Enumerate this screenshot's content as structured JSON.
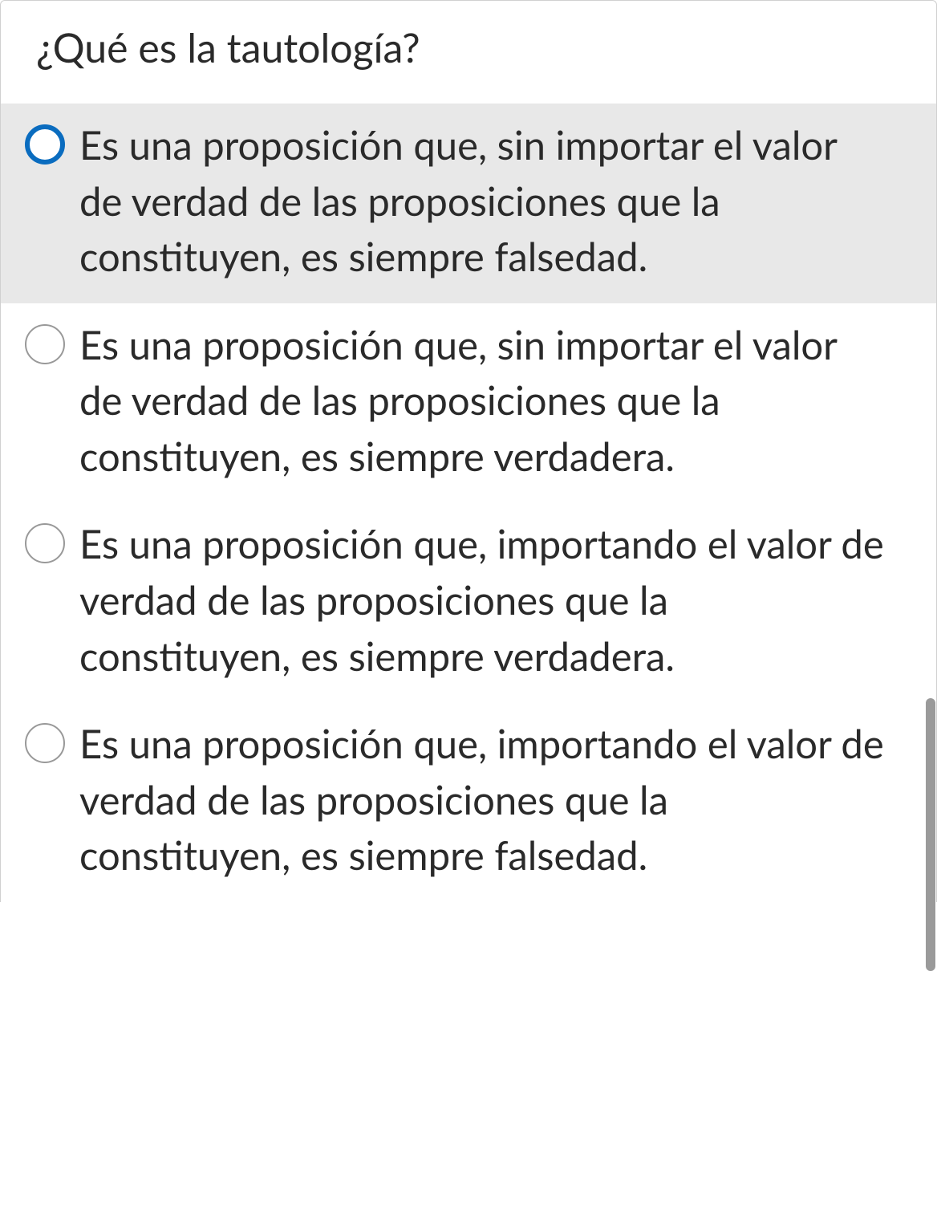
{
  "question": {
    "title": "¿Qué es la tautología?",
    "options": [
      {
        "text": "Es una proposición que, sin importar el valor de verdad de las proposiciones que la constituyen, es siempre falsedad.",
        "highlighted": true,
        "selected": true
      },
      {
        "text": "Es una proposición que, sin importar el valor de verdad de las proposiciones que la constituyen, es siempre verdadera.",
        "highlighted": false,
        "selected": false
      },
      {
        "text": "Es una proposición que, importando el valor de verdad de las proposiciones que la constituyen, es siempre verdadera.",
        "highlighted": false,
        "selected": false
      },
      {
        "text": "Es una proposición que, importando el valor de verdad de las proposiciones que la constituyen, es siempre falsedad.",
        "highlighted": false,
        "selected": false
      }
    ]
  }
}
